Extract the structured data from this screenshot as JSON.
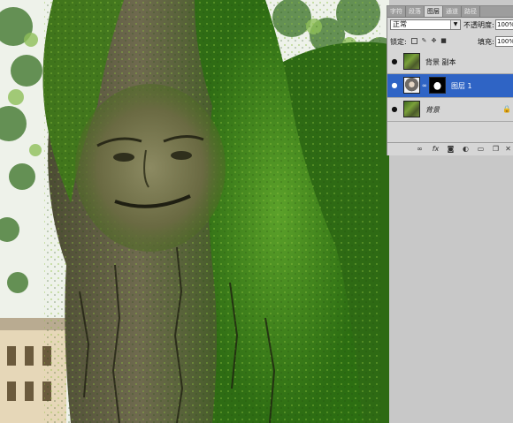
{
  "panel": {
    "tabs": [
      "字符",
      "段落",
      "图层",
      "通道",
      "路径"
    ],
    "active_tab": "图层",
    "blend_mode": "正常",
    "opacity_label": "不透明度:",
    "opacity_value": "100%",
    "lock_label": "锁定:",
    "fill_label": "填充:",
    "fill_value": "100%",
    "layers": [
      {
        "name": "背景 副本",
        "thumb": "tree",
        "visible": true,
        "selected": false
      },
      {
        "name": "图层 1",
        "thumb": "face",
        "has_mask": true,
        "visible": true,
        "selected": true
      },
      {
        "name": "背景",
        "thumb": "tree",
        "visible": true,
        "selected": false,
        "locked": true
      }
    ],
    "footer_icons": [
      "link-icon",
      "fx-icon",
      "mask-icon",
      "adjustment-icon",
      "group-icon",
      "new-layer-icon",
      "trash-icon"
    ]
  },
  "colors": {
    "panel_bg": "#d6d6d6",
    "selection": "#2f64c5",
    "moss": "#3f8a1a"
  }
}
